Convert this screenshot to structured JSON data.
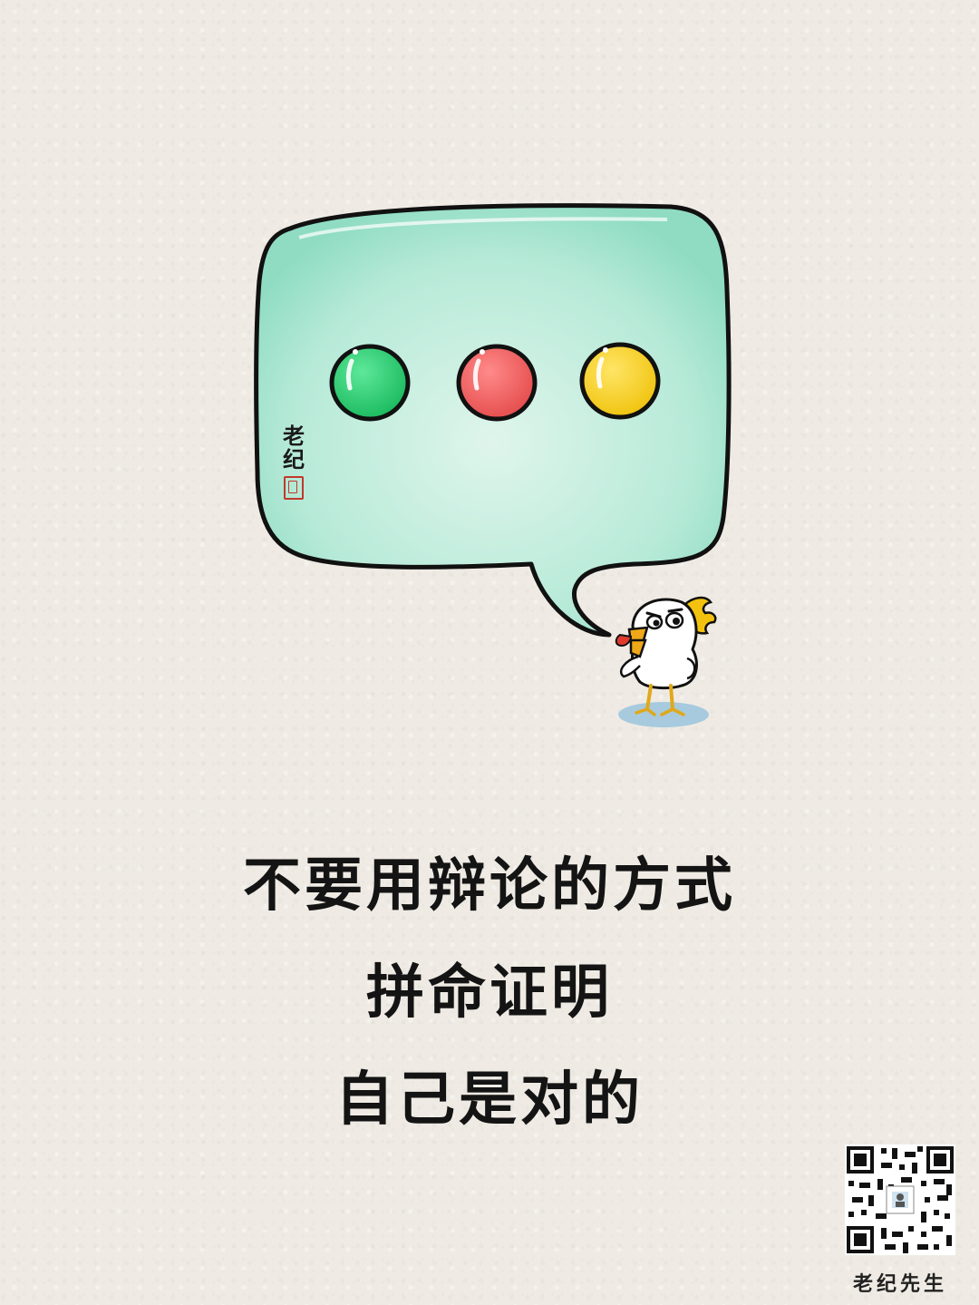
{
  "signature": {
    "chars": [
      "老",
      "纪"
    ]
  },
  "caption": {
    "lines": [
      "不要用辩论的方式",
      "拼命证明",
      "自己是对的"
    ]
  },
  "brand": {
    "name": "老纪先生"
  },
  "colors": {
    "bubble_fill": "#a8e6d2",
    "dot_green": "#2ecc71",
    "dot_red": "#ec5f5f",
    "dot_yellow": "#f5d11a",
    "ink": "#141414"
  },
  "icons": [
    "speech-bubble-icon",
    "chicken-character-icon",
    "qr-code-icon",
    "seal-stamp-icon"
  ]
}
